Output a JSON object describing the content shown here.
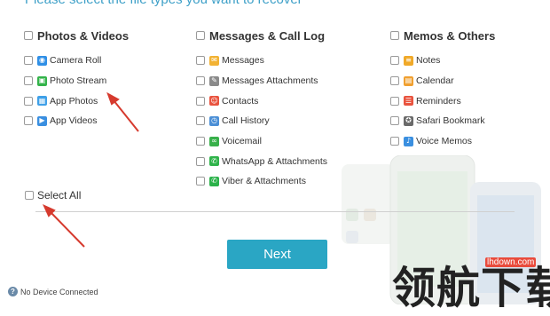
{
  "header": {
    "title": "Please select the file types you want to recover"
  },
  "groups": [
    {
      "label": "Photos & Videos",
      "items": [
        {
          "label": "Camera Roll",
          "icon": "camera-roll-icon",
          "color": "#2f8fe6",
          "glyph": "◉"
        },
        {
          "label": "Photo Stream",
          "icon": "photo-stream-icon",
          "color": "#33b34a",
          "glyph": "▣"
        },
        {
          "label": "App Photos",
          "icon": "app-photos-icon",
          "color": "#3fa0e8",
          "glyph": "▦"
        },
        {
          "label": "App Videos",
          "icon": "app-videos-icon",
          "color": "#3a8fe0",
          "glyph": "▶"
        }
      ]
    },
    {
      "label": "Messages & Call Log",
      "items": [
        {
          "label": "Messages",
          "icon": "messages-icon",
          "color": "#f2b233",
          "glyph": "✉"
        },
        {
          "label": "Messages Attachments",
          "icon": "attachments-icon",
          "color": "#8a8a8a",
          "glyph": "✎"
        },
        {
          "label": "Contacts",
          "icon": "contacts-icon",
          "color": "#e9533e",
          "glyph": "☺"
        },
        {
          "label": "Call History",
          "icon": "call-history-icon",
          "color": "#4b8fd6",
          "glyph": "◷"
        },
        {
          "label": "Voicemail",
          "icon": "voicemail-icon",
          "color": "#38b04a",
          "glyph": "∞"
        },
        {
          "label": "WhatsApp & Attachments",
          "icon": "whatsapp-icon",
          "color": "#2fb34a",
          "glyph": "✆"
        },
        {
          "label": "Viber & Attachments",
          "icon": "viber-icon",
          "color": "#2bb24a",
          "glyph": "✆"
        }
      ]
    },
    {
      "label": "Memos & Others",
      "items": [
        {
          "label": "Notes",
          "icon": "notes-icon",
          "color": "#f0a928",
          "glyph": "≡"
        },
        {
          "label": "Calendar",
          "icon": "calendar-icon",
          "color": "#f0a030",
          "glyph": "▤"
        },
        {
          "label": "Reminders",
          "icon": "reminders-icon",
          "color": "#e9533e",
          "glyph": "☰"
        },
        {
          "label": "Safari Bookmark",
          "icon": "safari-bookmark-icon",
          "color": "#6a6a6a",
          "glyph": "✪"
        },
        {
          "label": "Voice Memos",
          "icon": "voice-memos-icon",
          "color": "#3a8fe0",
          "glyph": "♪"
        }
      ]
    }
  ],
  "select_all": "Select All",
  "next_button": "Next",
  "status": "No Device Connected",
  "watermark": {
    "text": "领航下载",
    "url": "lhdown.com"
  },
  "colors": {
    "accent": "#2aa6c4",
    "title": "#3ea0c8",
    "arrow": "#d63a2e"
  }
}
